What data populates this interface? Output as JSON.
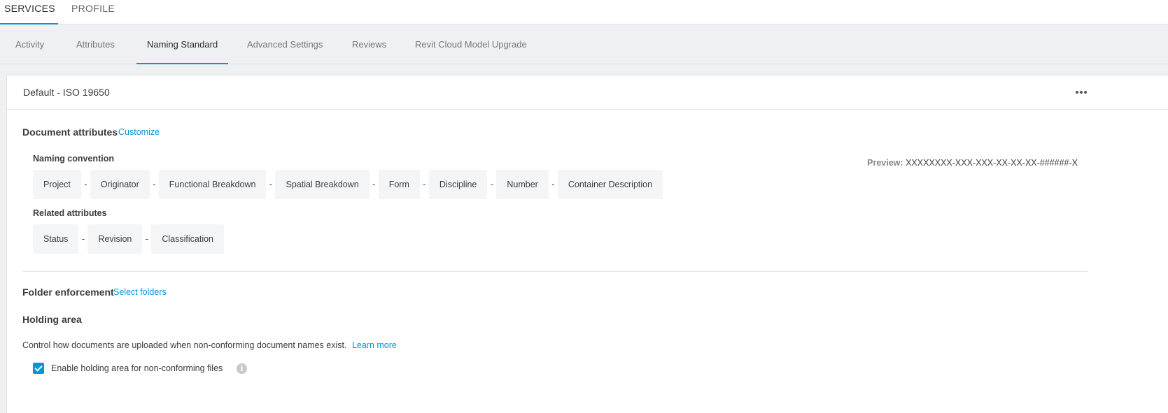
{
  "top_tabs": [
    {
      "label": "SERVICES",
      "active": true
    },
    {
      "label": "PROFILE",
      "active": false
    }
  ],
  "sub_tabs": [
    {
      "label": "Activity",
      "active": false
    },
    {
      "label": "Attributes",
      "active": false
    },
    {
      "label": "Naming Standard",
      "active": true
    },
    {
      "label": "Advanced Settings",
      "active": false
    },
    {
      "label": "Reviews",
      "active": false
    },
    {
      "label": "Revit Cloud Model Upgrade",
      "active": false
    }
  ],
  "card": {
    "title": "Default - ISO 19650",
    "more_icon": "more-horizontal-icon"
  },
  "document_attributes": {
    "title": "Document attributes",
    "customize_link": "Customize",
    "naming_convention_label": "Naming convention",
    "preview_label": "Preview:",
    "preview_value": "XXXXXXXX-XXX-XXX-XX-XX-XX-######-X",
    "naming_chips": [
      "Project",
      "Originator",
      "Functional Breakdown",
      "Spatial Breakdown",
      "Form",
      "Discipline",
      "Number",
      "Container Description"
    ],
    "separator": "-",
    "related_label": "Related attributes",
    "related_chips": [
      "Status",
      "Revision",
      "Classification"
    ]
  },
  "folder_enforcement": {
    "title": "Folder enforcement",
    "link": "Select folders"
  },
  "holding_area": {
    "title": "Holding area",
    "description": "Control how documents are uploaded when non-conforming document names exist.",
    "learn_more": "Learn more",
    "checkbox_label": "Enable holding area for non-conforming files",
    "checkbox_checked": true,
    "info_icon": "info-icon",
    "info_glyph": "i"
  },
  "colors": {
    "accent": "#0696d7",
    "background": "#eef0f2",
    "chip_bg": "#f4f5f6"
  }
}
